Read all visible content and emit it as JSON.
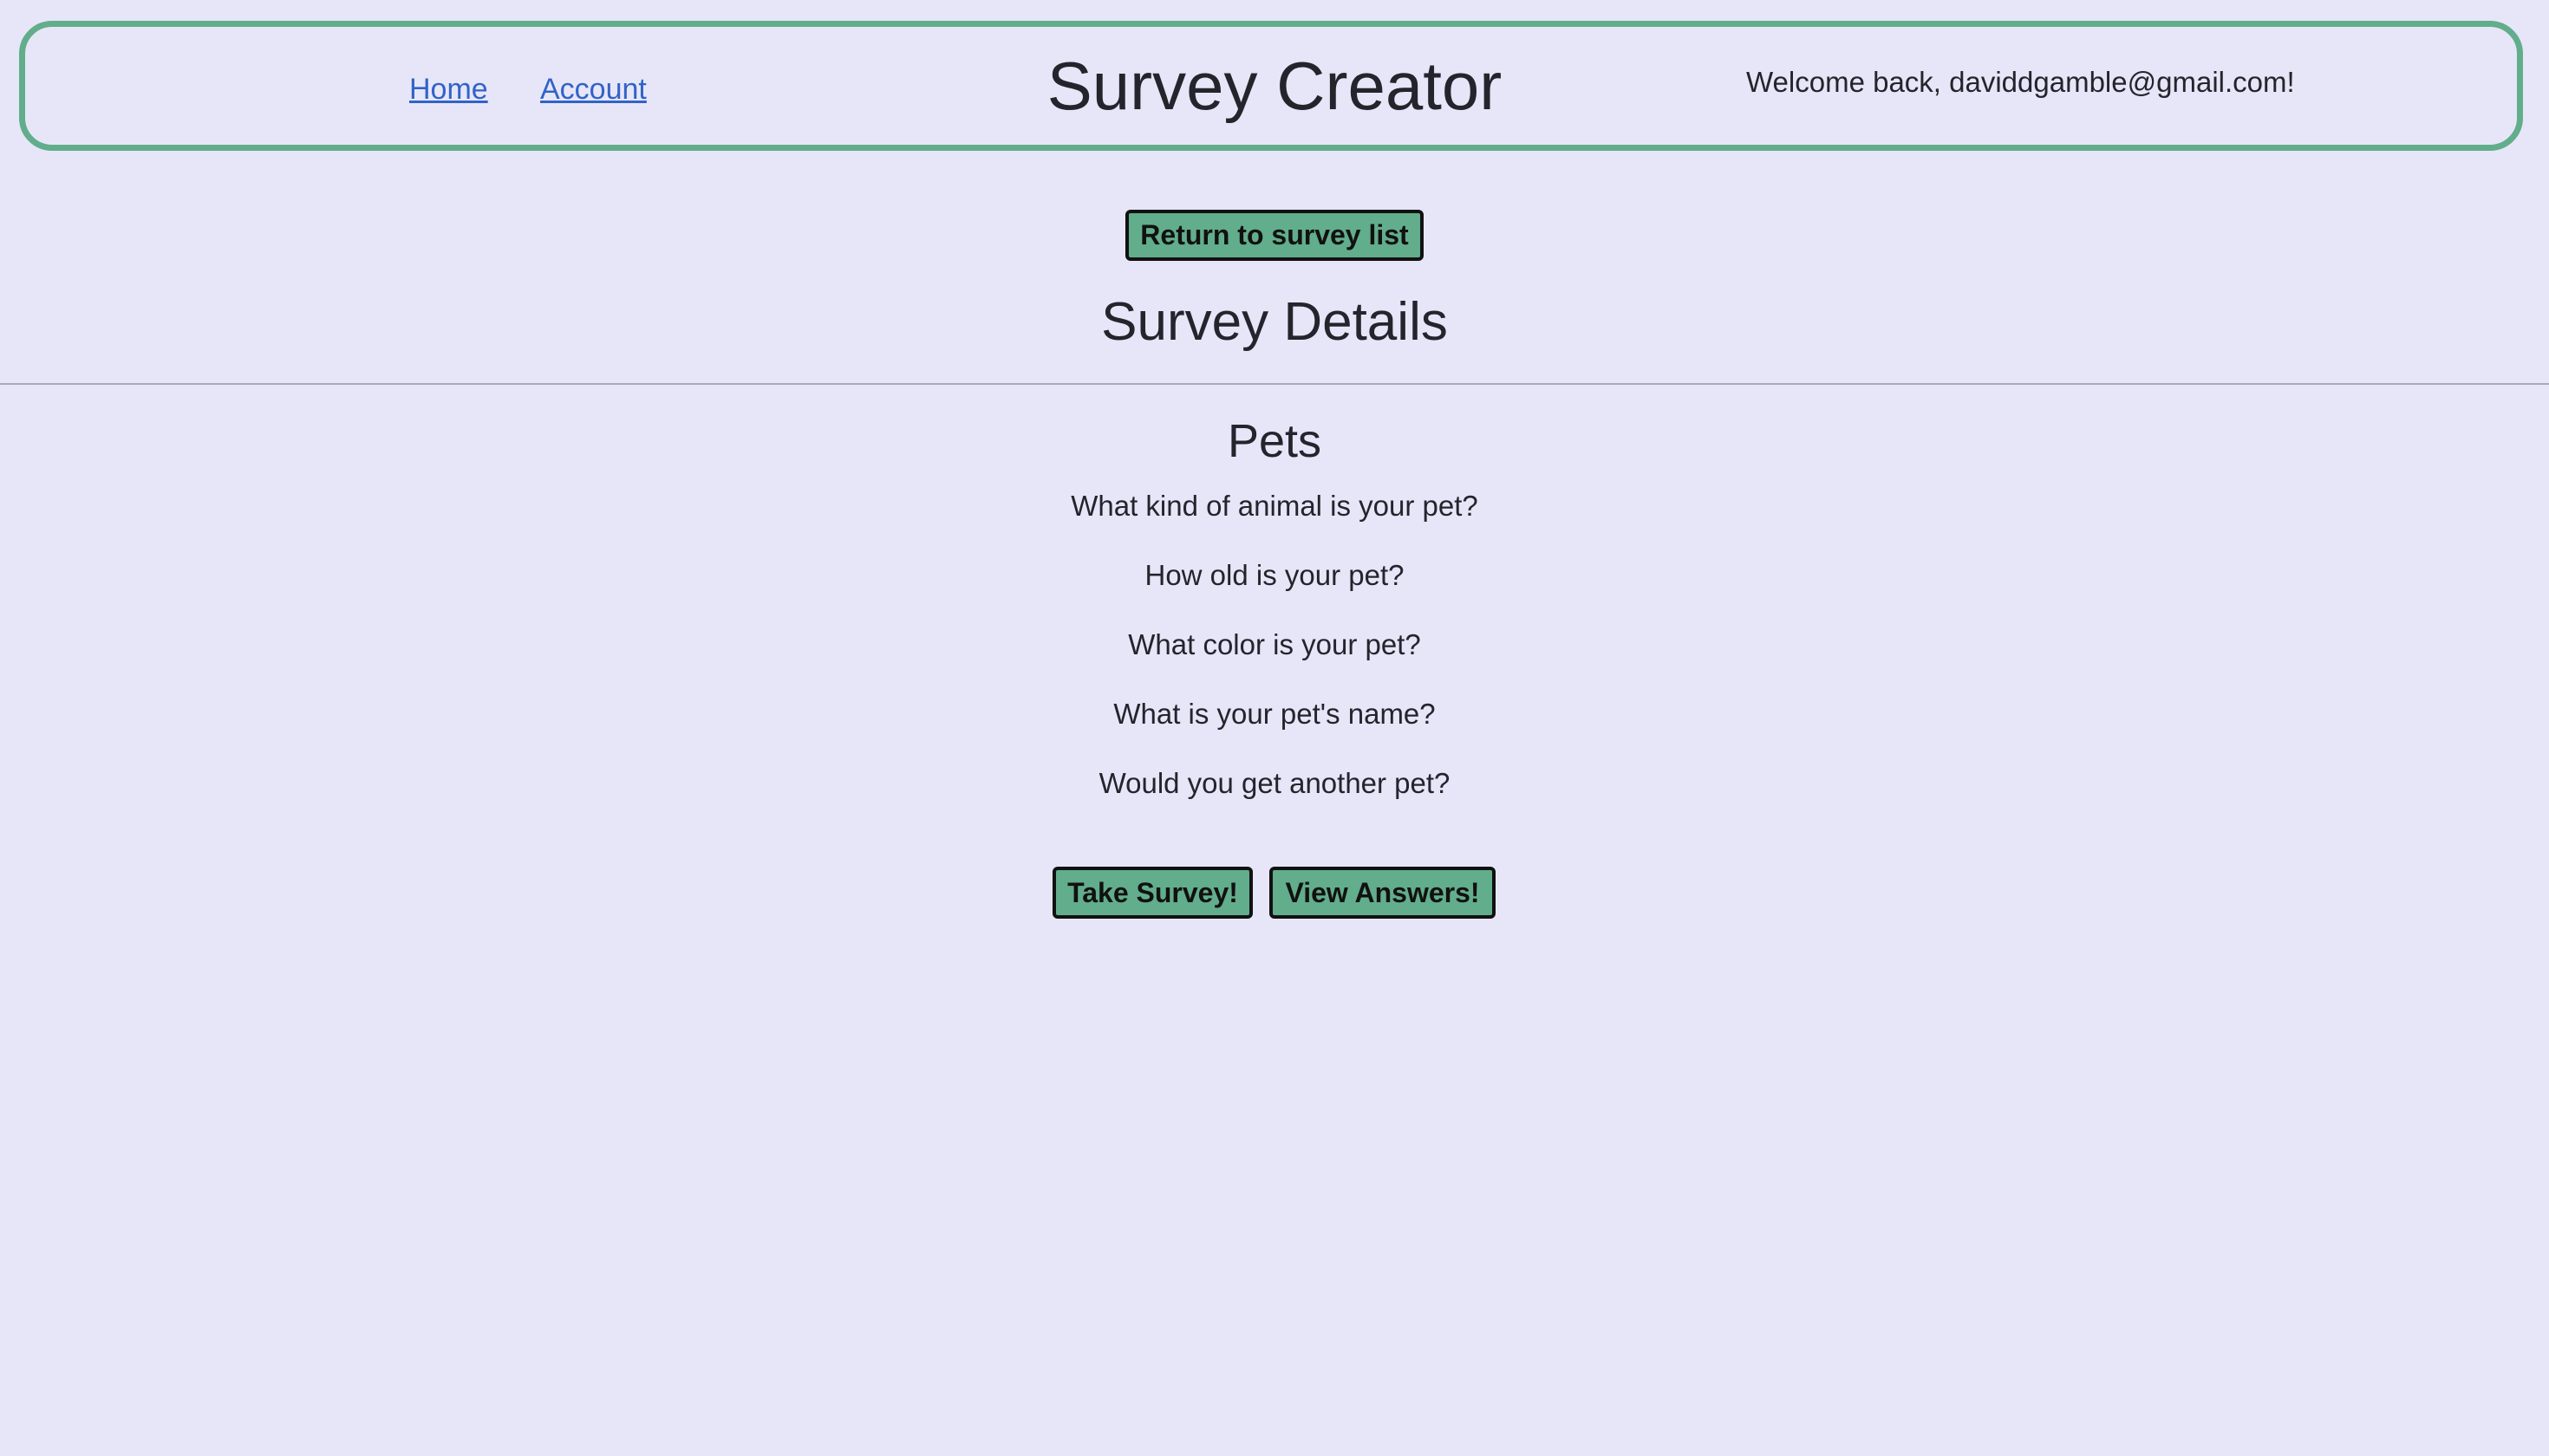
{
  "header": {
    "nav": {
      "home_label": "Home",
      "account_label": "Account"
    },
    "title": "Survey Creator",
    "welcome_text": "Welcome back, daviddgamble@gmail.com!"
  },
  "main": {
    "return_button_label": "Return to survey list",
    "page_heading": "Survey Details",
    "survey": {
      "title": "Pets",
      "questions": [
        "What kind of animal is your pet?",
        "How old is your pet?",
        "What color is your pet?",
        "What is your pet's name?",
        "Would you get another pet?"
      ]
    },
    "actions": {
      "take_survey_label": "Take Survey!",
      "view_answers_label": "View Answers!"
    }
  },
  "colors": {
    "background": "#e7e6f8",
    "accent_green": "#62ad8c",
    "link_blue": "#3163c8",
    "text": "#22252c"
  }
}
